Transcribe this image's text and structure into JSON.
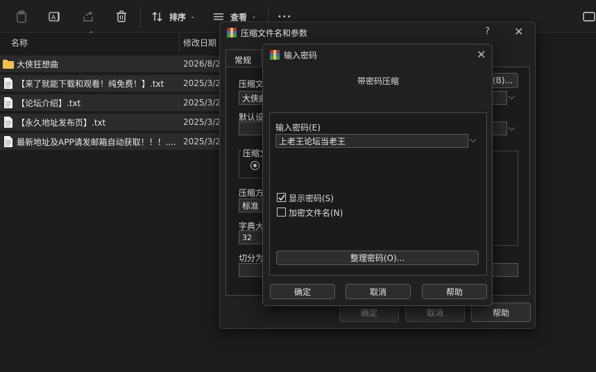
{
  "toolbar": {
    "sort_label": "排序",
    "view_label": "查看",
    "more_label": "•••"
  },
  "file_list": {
    "col_name": "名称",
    "col_modified": "修改日期",
    "rows": [
      {
        "name": "大侠狂想曲",
        "date": "2026/8/2",
        "type": "folder"
      },
      {
        "name": "【来了就能下载和观看！纯免费！】.txt",
        "date": "2025/3/2",
        "type": "txt"
      },
      {
        "name": "【论坛介绍】.txt",
        "date": "2025/3/2",
        "type": "txt"
      },
      {
        "name": "【永久地址发布页】.txt",
        "date": "2025/3/2",
        "type": "txt"
      },
      {
        "name": "最新地址及APP请发邮箱自动获取！！！....",
        "date": "2025/3/2",
        "type": "txt"
      }
    ]
  },
  "archive_dialog": {
    "title": "压缩文件名和参数",
    "help_glyph": "?",
    "tab_general": "常规",
    "label_archive_name": "压缩文",
    "archive_name_value": "大侠曲",
    "browse_button": "(B)...",
    "label_default": "默认设",
    "group_format": "压缩文",
    "label_method": "压缩方",
    "method_value": "标准",
    "label_dict": "字典大",
    "dict_value": "32",
    "label_split": "切分为",
    "ok": "确定",
    "cancel": "取消",
    "help": "帮助"
  },
  "password_dialog": {
    "title": "输入密码",
    "heading": "带密码压缩",
    "label_password": "输入密码(E)",
    "password_value": "上老王论坛当老王",
    "show_password": "显示密码(S)",
    "show_password_checked": true,
    "encrypt_names": "加密文件名(N)",
    "encrypt_names_checked": false,
    "organize_button": "整理密码(O)...",
    "ok": "确定",
    "cancel": "取消",
    "help": "帮助"
  }
}
